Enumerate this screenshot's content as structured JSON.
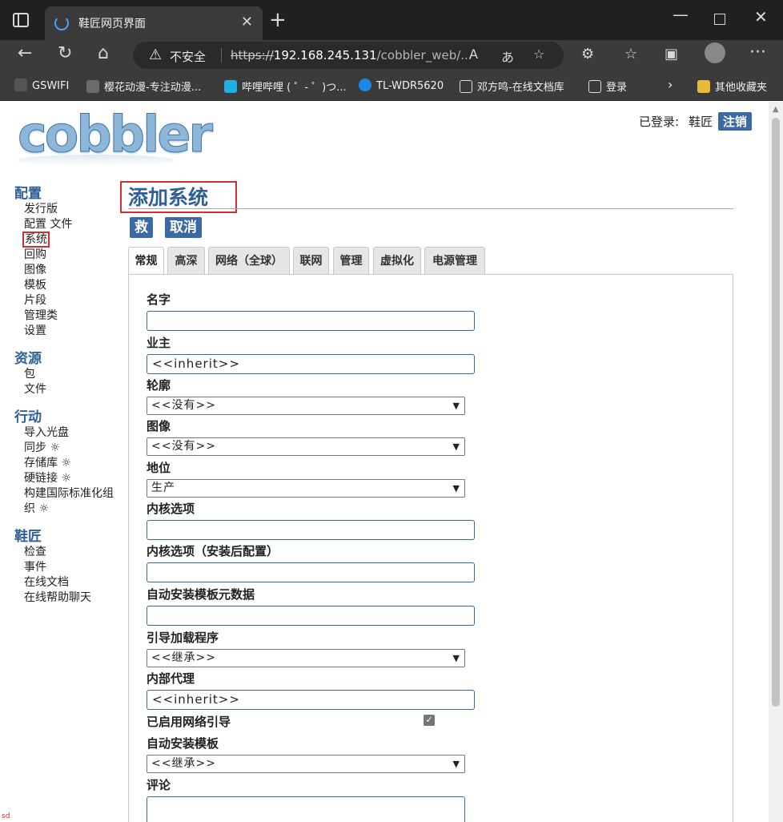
{
  "browser": {
    "tab_title": "鞋匠网页界面",
    "insecure_label": "不安全",
    "url_scheme": "https://",
    "url_host": "192.168.245.131",
    "url_path": "/cobbler_web/...",
    "bookmarks": [
      "GSWIFI",
      "樱花动漫-专注动漫...",
      "哔哩哔哩 ( ゜- ゜)つ...",
      "TL-WDR5620",
      "邓方鸣-在线文档库",
      "登录",
      "其他收藏夹"
    ]
  },
  "header": {
    "logo": "cobbler",
    "logged_in_label": "已登录:",
    "username": "鞋匠",
    "logout_label": "注销"
  },
  "nav": {
    "groups": [
      {
        "title": "配置",
        "items": [
          "发行版",
          "配置 文件",
          "系统",
          "回购",
          "图像",
          "模板",
          "片段",
          "管理类",
          "设置"
        ]
      },
      {
        "title": "资源",
        "items": [
          "包",
          "文件"
        ]
      },
      {
        "title": "行动",
        "items": [
          "导入光盘",
          "同步 ☼",
          "存储库 ☼",
          "硬链接 ☼",
          "构建国际标准化组织 ☼"
        ]
      },
      {
        "title": "鞋匠",
        "items": [
          "检查",
          "事件",
          "在线文档",
          "在线帮助聊天"
        ]
      }
    ]
  },
  "main": {
    "title": "添加系统",
    "save_label": "救",
    "cancel_label": "取消",
    "tabs": [
      "常规",
      "高深",
      "网络（全球）",
      "联网",
      "管理",
      "虚拟化",
      "电源管理"
    ],
    "fields": {
      "name_label": "名字",
      "name_value": "",
      "owner_label": "业主",
      "owner_value": "<<inherit>>",
      "profile_label": "轮廓",
      "profile_value": "<<没有>>",
      "image_label": "图像",
      "image_value": "<<没有>>",
      "status_label": "地位",
      "status_value": "生产",
      "kernel_opts_label": "内核选项",
      "kernel_opts_value": "",
      "kernel_post_label": "内核选项（安装后配置）",
      "kernel_post_value": "",
      "autoinstall_meta_label": "自动安装模板元数据",
      "autoinstall_meta_value": "",
      "bootloader_label": "引导加载程序",
      "bootloader_value": "<<继承>>",
      "proxy_label": "内部代理",
      "proxy_value": "<<inherit>>",
      "netboot_label": "已启用网络引导",
      "netboot_checked": true,
      "autoinstall_label": "自动安装模板",
      "autoinstall_value": "<<继承>>",
      "comment_label": "评论",
      "comment_value": ""
    }
  },
  "misc": {
    "corner_text": "sd"
  },
  "colors": {
    "accent": "#3a6aa0",
    "heading": "#2e5f97",
    "highlight_box": "#d32f2f"
  }
}
